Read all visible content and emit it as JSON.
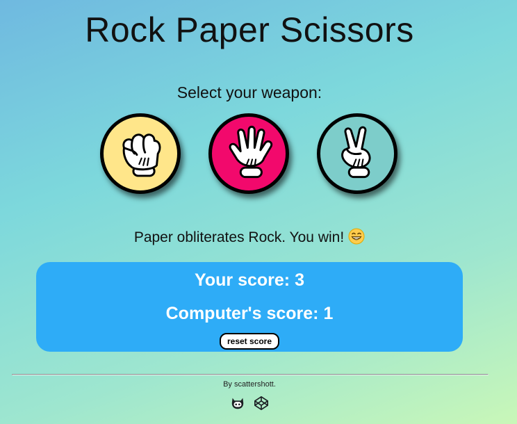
{
  "game": {
    "title": "Rock Paper Scissors",
    "prompt": "Select your weapon:"
  },
  "weapons": [
    {
      "name": "Rock",
      "icon": "rock-hand-icon",
      "color": "#ffe68a"
    },
    {
      "name": "Paper",
      "icon": "paper-hand-icon",
      "color": "#f2096c"
    },
    {
      "name": "Scissors",
      "icon": "scissors-hand-icon",
      "color": "#7dcdca"
    }
  ],
  "result": {
    "text": "Paper obliterates Rock. You win!",
    "emoji": "grinning-face-icon"
  },
  "scoreboard": {
    "player_label": "Your score:",
    "player_score": "3",
    "computer_label": "Computer's score:",
    "computer_score": "1",
    "reset_label": "reset score",
    "background": "#2eacf7"
  },
  "footer": {
    "credit": "By scattershott.",
    "links": [
      {
        "icon": "github-icon"
      },
      {
        "icon": "codepen-icon"
      }
    ]
  }
}
